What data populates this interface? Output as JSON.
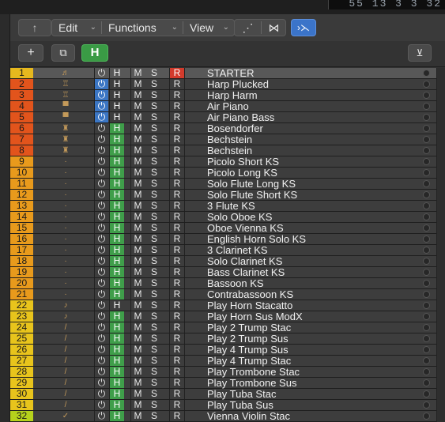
{
  "lcd": {
    "text": "55 13 3 3 32"
  },
  "toolbar": {
    "up_icon": "↑",
    "menus": [
      {
        "label": "Edit",
        "chev": "⌄"
      },
      {
        "label": "Functions",
        "chev": "⌄"
      },
      {
        "label": "View",
        "chev": "⌄"
      }
    ],
    "tools": {
      "automation_icon": "⋰",
      "flex_icon": "⋈"
    },
    "catch_icon": "›⋋"
  },
  "subbar": {
    "add_icon": "+",
    "duplicate_icon": "⧉",
    "hide_label": "H",
    "filter_icon": "⊻"
  },
  "track_buttons": {
    "power": "⏻",
    "h": "H",
    "m": "M",
    "s": "S",
    "r": "R"
  },
  "tracks": [
    {
      "num": "1",
      "name": "STARTER",
      "color": "#e6b81e",
      "pw_on": false,
      "h_on": false,
      "r_on": true,
      "icon": "♬"
    },
    {
      "num": "2",
      "name": "Harp Plucked",
      "color": "#e2541c",
      "pw_on": true,
      "h_on": false,
      "r_on": false,
      "icon": "♖"
    },
    {
      "num": "3",
      "name": "Harp Harm",
      "color": "#e2541c",
      "pw_on": true,
      "h_on": false,
      "r_on": false,
      "icon": "♖"
    },
    {
      "num": "4",
      "name": "Air Piano",
      "color": "#e2541c",
      "pw_on": true,
      "h_on": false,
      "r_on": false,
      "icon": "▀"
    },
    {
      "num": "5",
      "name": "Air Piano Bass",
      "color": "#e2541c",
      "pw_on": true,
      "h_on": false,
      "r_on": false,
      "icon": "▀"
    },
    {
      "num": "6",
      "name": "Bosendorfer",
      "color": "#e2541c",
      "pw_on": false,
      "h_on": true,
      "r_on": false,
      "icon": "♜"
    },
    {
      "num": "7",
      "name": "Bechstein",
      "color": "#e2541c",
      "pw_on": false,
      "h_on": true,
      "r_on": false,
      "icon": "♜"
    },
    {
      "num": "8",
      "name": "Bechstein",
      "color": "#e2541c",
      "pw_on": false,
      "h_on": true,
      "r_on": false,
      "icon": "♜"
    },
    {
      "num": "9",
      "name": "Picolo Short KS",
      "color": "#e89a1c",
      "pw_on": false,
      "h_on": true,
      "r_on": false,
      "icon": "·"
    },
    {
      "num": "10",
      "name": "Picolo Long KS",
      "color": "#e89a1c",
      "pw_on": false,
      "h_on": true,
      "r_on": false,
      "icon": "·"
    },
    {
      "num": "11",
      "name": "Solo Flute Long KS",
      "color": "#e89a1c",
      "pw_on": false,
      "h_on": true,
      "r_on": false,
      "icon": "·"
    },
    {
      "num": "12",
      "name": "Solo Flute Short KS",
      "color": "#e89a1c",
      "pw_on": false,
      "h_on": true,
      "r_on": false,
      "icon": "·"
    },
    {
      "num": "13",
      "name": "3 Flute KS",
      "color": "#e89a1c",
      "pw_on": false,
      "h_on": true,
      "r_on": false,
      "icon": "·"
    },
    {
      "num": "14",
      "name": "Solo Oboe KS",
      "color": "#e89a1c",
      "pw_on": false,
      "h_on": true,
      "r_on": false,
      "icon": "·"
    },
    {
      "num": "15",
      "name": "Oboe Vienna KS",
      "color": "#e89a1c",
      "pw_on": false,
      "h_on": true,
      "r_on": false,
      "icon": "·"
    },
    {
      "num": "16",
      "name": "English Horn Solo KS",
      "color": "#e89a1c",
      "pw_on": false,
      "h_on": true,
      "r_on": false,
      "icon": "·"
    },
    {
      "num": "17",
      "name": "3 Clarinet KS",
      "color": "#e89a1c",
      "pw_on": false,
      "h_on": true,
      "r_on": false,
      "icon": "·"
    },
    {
      "num": "18",
      "name": "Solo Clarinet KS",
      "color": "#e89a1c",
      "pw_on": false,
      "h_on": true,
      "r_on": false,
      "icon": "·"
    },
    {
      "num": "19",
      "name": "Bass Clarinet KS",
      "color": "#e89a1c",
      "pw_on": false,
      "h_on": true,
      "r_on": false,
      "icon": "·"
    },
    {
      "num": "20",
      "name": "Bassoon KS",
      "color": "#e89a1c",
      "pw_on": false,
      "h_on": true,
      "r_on": false,
      "icon": "·"
    },
    {
      "num": "21",
      "name": "Contrabassoon KS",
      "color": "#e89a1c",
      "pw_on": false,
      "h_on": true,
      "r_on": false,
      "icon": "·"
    },
    {
      "num": "22",
      "name": "Play  Horn Stacatto",
      "color": "#e8c41c",
      "pw_on": false,
      "h_on": false,
      "r_on": false,
      "icon": "♪"
    },
    {
      "num": "23",
      "name": "Play  Horn Sus ModX",
      "color": "#e8c41c",
      "pw_on": false,
      "h_on": true,
      "r_on": false,
      "icon": "♪"
    },
    {
      "num": "24",
      "name": "Play 2 Trump Stac",
      "color": "#e8c41c",
      "pw_on": false,
      "h_on": true,
      "r_on": false,
      "icon": "/"
    },
    {
      "num": "25",
      "name": "Play 2 Trump Sus",
      "color": "#e8c41c",
      "pw_on": false,
      "h_on": true,
      "r_on": false,
      "icon": "/"
    },
    {
      "num": "26",
      "name": "Play 4 Trump Sus",
      "color": "#e8c41c",
      "pw_on": false,
      "h_on": true,
      "r_on": false,
      "icon": "/"
    },
    {
      "num": "27",
      "name": "Play 4 Trump Stac",
      "color": "#e8c41c",
      "pw_on": false,
      "h_on": true,
      "r_on": false,
      "icon": "/"
    },
    {
      "num": "28",
      "name": "Play Trombone Stac",
      "color": "#e8c41c",
      "pw_on": false,
      "h_on": true,
      "r_on": false,
      "icon": "/"
    },
    {
      "num": "29",
      "name": "Play Trombone Sus",
      "color": "#e8c41c",
      "pw_on": false,
      "h_on": true,
      "r_on": false,
      "icon": "/"
    },
    {
      "num": "30",
      "name": "Play Tuba Stac",
      "color": "#e8c41c",
      "pw_on": false,
      "h_on": true,
      "r_on": false,
      "icon": "/"
    },
    {
      "num": "31",
      "name": "Play Tuba Sus",
      "color": "#e8c41c",
      "pw_on": false,
      "h_on": true,
      "r_on": false,
      "icon": "/"
    },
    {
      "num": "32",
      "name": "Vienna Violin Stac",
      "color": "#b5d21c",
      "pw_on": false,
      "h_on": true,
      "r_on": false,
      "icon": "✓"
    }
  ]
}
